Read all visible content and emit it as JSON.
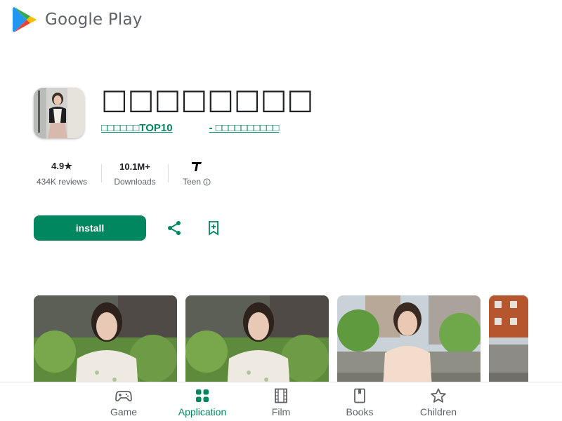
{
  "header": {
    "brand": "Google Play"
  },
  "app": {
    "title": "□□□□□□□□",
    "developer_left": "□□□□□□TOP10",
    "developer_right": "- □□□□□□□□□□",
    "icon": "app-icon-photo"
  },
  "stats": {
    "rating_value": "4.9★",
    "rating_label": "434K reviews",
    "downloads_value": "10.1M+",
    "downloads_label": "Downloads",
    "content_rating_label": "Teen",
    "content_rating_icon": "teen-rating-icon"
  },
  "actions": {
    "install_label": "install",
    "share_icon": "share-icon",
    "wishlist_icon": "bookmark-add-icon"
  },
  "screenshots": [
    "screenshot-1",
    "screenshot-2",
    "screenshot-3",
    "screenshot-4"
  ],
  "nav": {
    "items": [
      {
        "label": "Game",
        "icon": "gamepad-icon",
        "active": false
      },
      {
        "label": "Application",
        "icon": "apps-icon",
        "active": true
      },
      {
        "label": "Film",
        "icon": "film-icon",
        "active": false
      },
      {
        "label": "Books",
        "icon": "book-icon",
        "active": false
      },
      {
        "label": "Children",
        "icon": "star-icon",
        "active": false
      }
    ]
  },
  "colors": {
    "accent": "#01875f",
    "text": "#202124",
    "muted": "#5f6368"
  }
}
